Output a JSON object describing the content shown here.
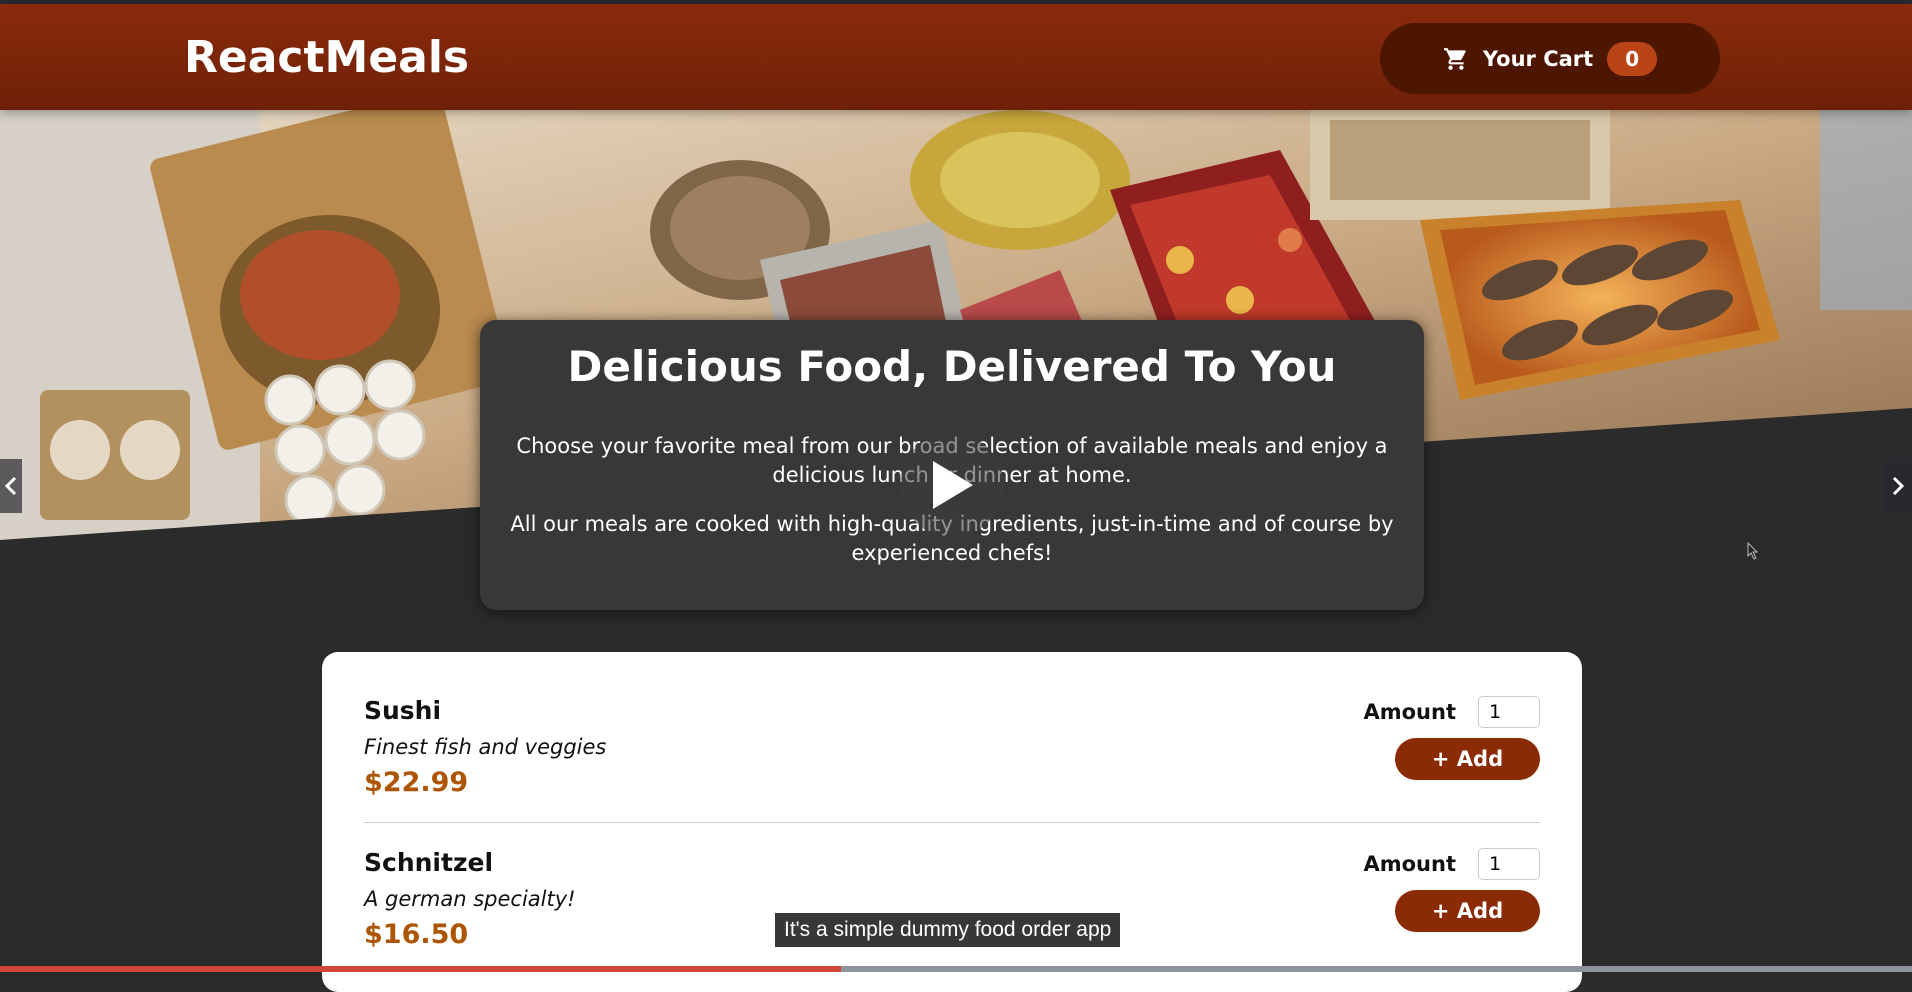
{
  "header": {
    "logo": "ReactMeals",
    "cart": {
      "label": "Your Cart",
      "count": "0",
      "icon": "cart-icon"
    }
  },
  "hero": {
    "title": "Delicious Food, Delivered To You",
    "paragraph1": "Choose your favorite meal from our broad selection of available meals and enjoy a delicious lunch or dinner at home.",
    "paragraph2": "All our meals are cooked with high-quality ingredients, just-in-time and of course by experienced chefs!"
  },
  "meals": [
    {
      "name": "Sushi",
      "description": "Finest fish and veggies",
      "price": "$22.99",
      "amount_label": "Amount",
      "amount_value": "1",
      "add_label": "+ Add"
    },
    {
      "name": "Schnitzel",
      "description": "A german specialty!",
      "price": "$16.50",
      "amount_label": "Amount",
      "amount_value": "1",
      "add_label": "+ Add"
    }
  ],
  "video": {
    "caption": "It's a simple dummy food order app",
    "progress": 0.44,
    "controls": [
      "play-icon",
      "chevron-left-icon",
      "chevron-right-icon"
    ]
  },
  "colors": {
    "header": "#8a2b06",
    "cart_button": "#4d1601",
    "badge": "#b94517",
    "price": "#ad5502",
    "add_button": "#8a2b06",
    "background": "#2b2b2b"
  }
}
